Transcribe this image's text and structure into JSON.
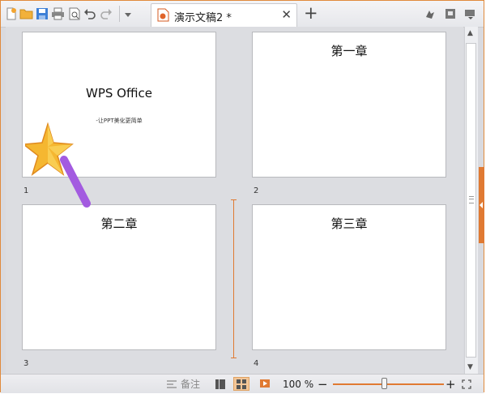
{
  "window": {
    "tab": {
      "title": "演示文稿2 *"
    },
    "colors": {
      "accent": "#e07a33",
      "background": "#dcdde1",
      "slide": "#ffffff"
    }
  },
  "toolbar": {
    "icons": [
      "new-icon",
      "open-folder-icon",
      "save-icon",
      "print-icon",
      "print-preview-icon",
      "undo-icon",
      "redo-icon",
      "dropdown-icon"
    ],
    "right_icons": [
      "skin-icon",
      "minimize-panel-icon",
      "menu-icon"
    ]
  },
  "slides": [
    {
      "number": "1",
      "title": "WPS Office",
      "subtitle": "-让PPT美化更简单"
    },
    {
      "number": "2",
      "title": "第一章"
    },
    {
      "number": "3",
      "title": "第二章"
    },
    {
      "number": "4",
      "title": "第三章"
    }
  ],
  "status_bar": {
    "notes_label": "备注",
    "zoom_value": "100 %",
    "zoom_level": 0.46,
    "view_modes": [
      "normal-view-icon",
      "slide-sorter-view-icon",
      "slideshow-icon"
    ]
  }
}
